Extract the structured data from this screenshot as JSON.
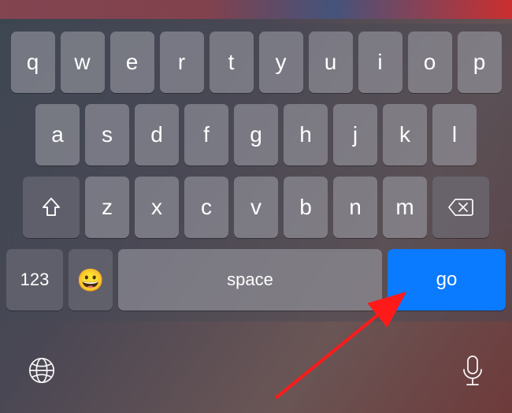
{
  "keyboard": {
    "row1": [
      "q",
      "w",
      "e",
      "r",
      "t",
      "y",
      "u",
      "i",
      "o",
      "p"
    ],
    "row2": [
      "a",
      "s",
      "d",
      "f",
      "g",
      "h",
      "j",
      "k",
      "l"
    ],
    "row3": [
      "z",
      "x",
      "c",
      "v",
      "b",
      "n",
      "m"
    ],
    "numbers_label": "123",
    "space_label": "space",
    "go_label": "go",
    "emoji_glyph": "😀"
  },
  "annotation": {
    "arrow_color": "#ff1a1a",
    "arrow_target": "go-button"
  }
}
